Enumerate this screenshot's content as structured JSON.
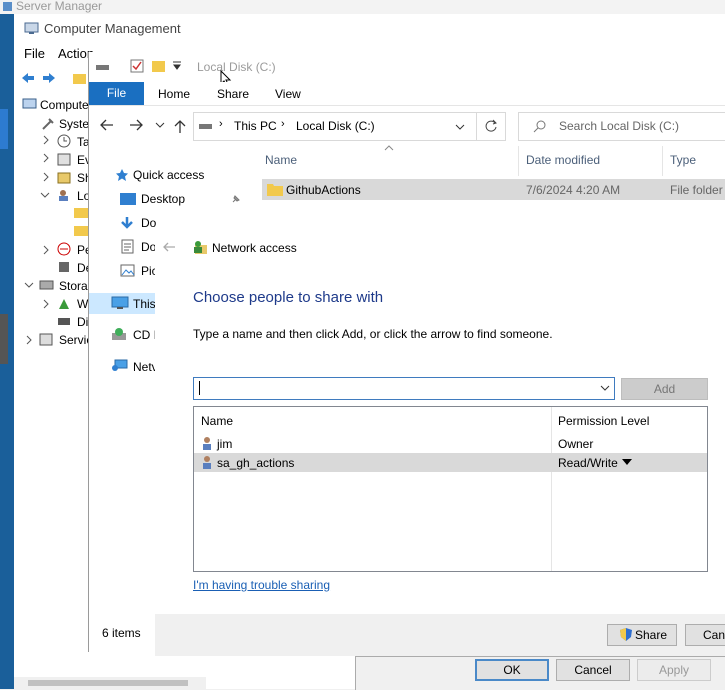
{
  "server_manager": {
    "title": "Server Manager"
  },
  "computer_management": {
    "title": "Computer Management",
    "menu": {
      "file": "File",
      "action": "Action"
    },
    "tree": {
      "computer": "Compute",
      "system_tools": "Syste",
      "task_scheduler": "Ta",
      "event_viewer": "Ev",
      "shared_folders": "Sh",
      "local_users": "Lo",
      "performance": "Pe",
      "device_manager": "De",
      "storage": "Stora",
      "wsb": "W",
      "disk_mgmt": "Di",
      "services": "Servic"
    }
  },
  "explorer": {
    "title": "Local Disk (C:)",
    "ribbon_tabs": {
      "file": "File",
      "home": "Home",
      "share": "Share",
      "view": "View"
    },
    "breadcrumb": {
      "this_pc": "This PC",
      "drive": "Local Disk (C:)"
    },
    "search_placeholder": "Search Local Disk (C:)",
    "nav": {
      "quick_access": "Quick access",
      "desktop": "Desktop",
      "downloads": "Do",
      "documents": "Do",
      "pictures": "Pic",
      "this_pc": "This",
      "cd_drive": "CD I",
      "network": "Netv"
    },
    "columns": {
      "name": "Name",
      "date_modified": "Date modified",
      "type": "Type"
    },
    "files": [
      {
        "name": "GithubActions",
        "date": "7/6/2024 4:20 AM",
        "type": "File folder"
      }
    ],
    "status": "6 items"
  },
  "share_dialog": {
    "title": "Network access",
    "heading": "Choose people to share with",
    "description": "Type a name and then click Add, or click the arrow to find someone.",
    "input_value": "",
    "add_label": "Add",
    "columns": {
      "name": "Name",
      "permission": "Permission Level"
    },
    "rows": [
      {
        "name": "jim",
        "permission": "Owner"
      },
      {
        "name": "sa_gh_actions",
        "permission": "Read/Write"
      }
    ],
    "help_link": "I'm having trouble sharing",
    "share_label": "Share",
    "cancel_label": "Can"
  },
  "properties_dialog": {
    "ok": "OK",
    "cancel": "Cancel",
    "apply": "Apply"
  }
}
